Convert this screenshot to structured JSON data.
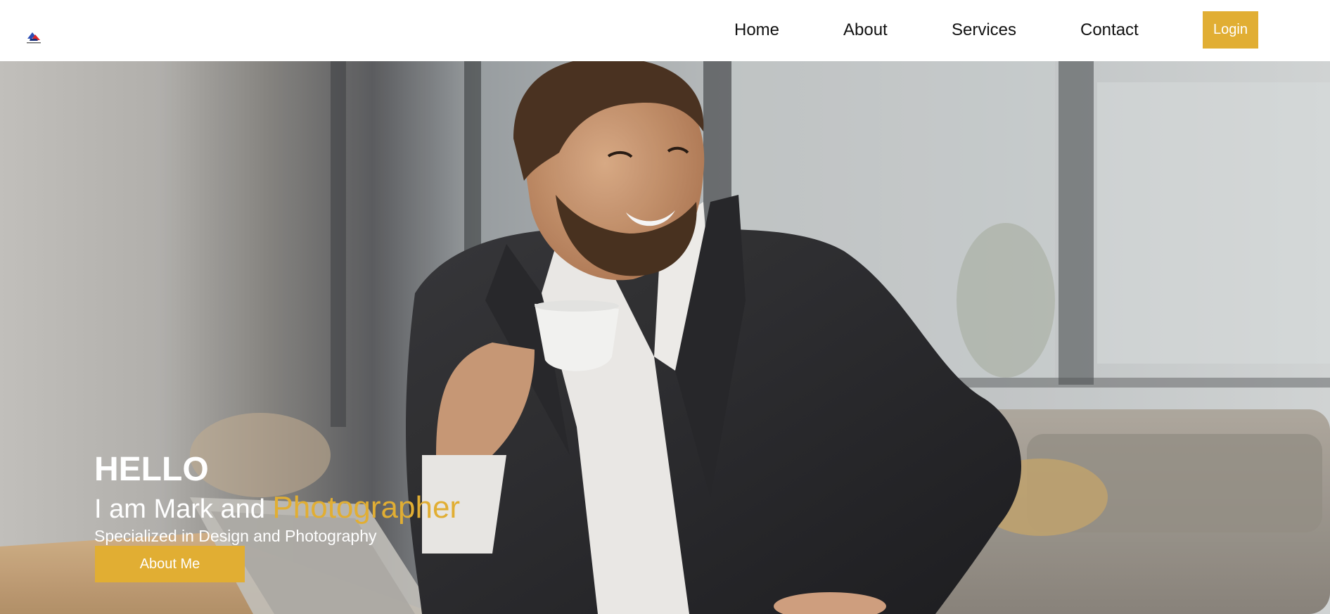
{
  "navbar": {
    "logo_icon": "triangle-logo-icon",
    "links": [
      {
        "label": "Home"
      },
      {
        "label": "About"
      },
      {
        "label": "Services"
      },
      {
        "label": "Contact"
      }
    ],
    "login_label": "Login"
  },
  "hero": {
    "greeting": "HELLO",
    "intro_prefix": "I am Mark and ",
    "intro_highlight": "Photographer",
    "subtitle": "Specialized in Design and Photography",
    "cta_label": "About Me",
    "photo_subject": "smiling man in dark blazer holding a coffee cup"
  },
  "colors": {
    "accent": "#e1ae33",
    "nav_background": "#ffffff",
    "nav_text": "#111111",
    "hero_text": "#ffffff"
  }
}
